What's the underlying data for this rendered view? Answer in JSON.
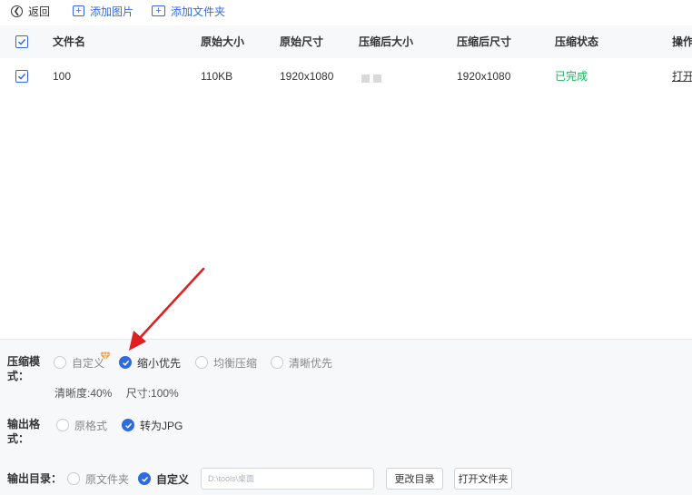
{
  "toolbar": {
    "back_label": "返回",
    "add_image_label": "添加图片",
    "add_folder_label": "添加文件夹"
  },
  "table": {
    "columns": [
      "文件名",
      "原始大小",
      "原始尺寸",
      "压缩后大小",
      "压缩后尺寸",
      "压缩状态",
      "操作"
    ],
    "rows": [
      {
        "checked": true,
        "filename": "100",
        "original_size": "110KB",
        "original_dimensions": "1920x1080",
        "compressed_size": "",
        "compressed_dimensions": "1920x1080",
        "status": "已完成",
        "action": "打开"
      }
    ]
  },
  "compress_mode": {
    "label": "压缩模式：",
    "options": [
      "自定义",
      "缩小优先",
      "均衡压缩",
      "清晰优先"
    ],
    "selected": "缩小优先",
    "clarity": "清晰度:40%",
    "size": "尺寸:100%"
  },
  "output_format": {
    "label": "输出格式：",
    "options": [
      "原格式",
      "转为JPG"
    ],
    "selected": "转为JPG"
  },
  "output_dir": {
    "label": "输出目录：",
    "options": [
      "原文件夹",
      "自定义"
    ],
    "selected": "自定义",
    "path": "D:\\tools\\桌面",
    "change_dir_label": "更改目录",
    "open_folder_label": "打开文件夹"
  },
  "colors": {
    "accent": "#2f6bde",
    "success": "#19b25a",
    "annotation_arrow": "#e02020",
    "vip_gem": "#f5a04a"
  },
  "icons": [
    "back-icon",
    "add-image-icon",
    "add-folder-icon",
    "checkbox-checked-icon",
    "radio-checked-icon",
    "vip-gem-icon",
    "annotation-arrow"
  ]
}
